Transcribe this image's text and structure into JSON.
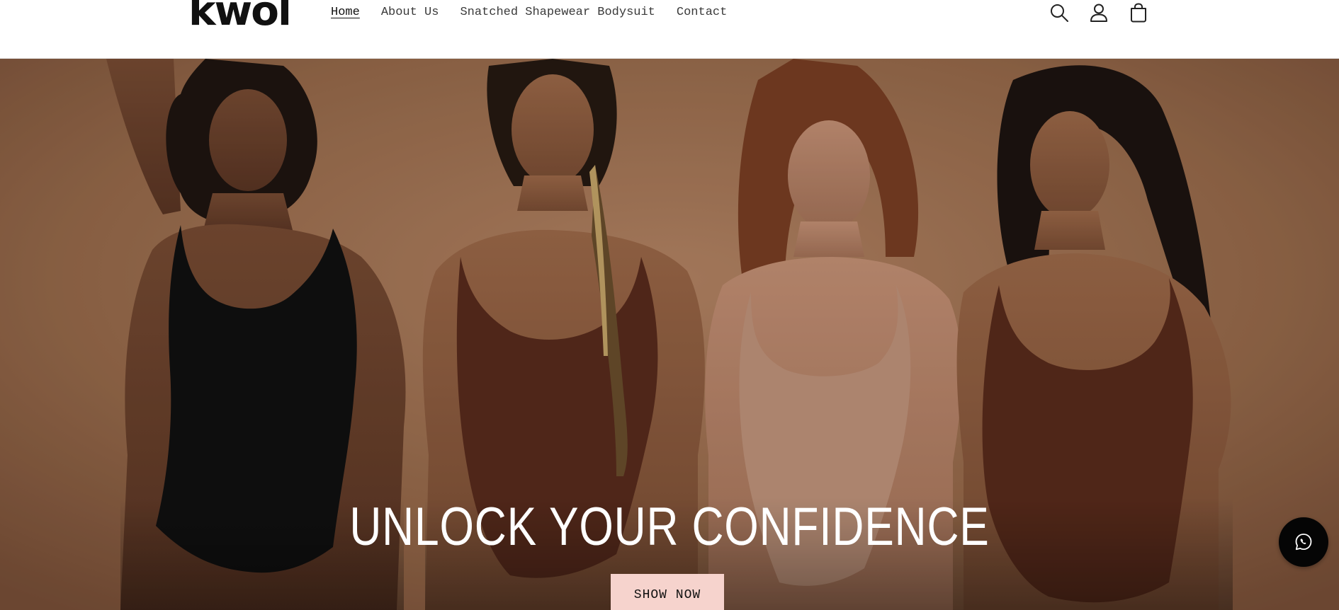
{
  "brand": {
    "logo_text": "kwol"
  },
  "nav": {
    "items": [
      {
        "label": "Home",
        "active": true
      },
      {
        "label": "About Us",
        "active": false
      },
      {
        "label": "Snatched Shapewear Bodysuit",
        "active": false
      },
      {
        "label": "Contact",
        "active": false
      }
    ]
  },
  "header_icons": [
    "search-icon",
    "account-icon",
    "cart-icon"
  ],
  "hero": {
    "headline": "UNLOCK YOUR CONFIDENCE",
    "cta_label": "SHOW NOW"
  },
  "floating": {
    "icon": "whatsapp-icon"
  },
  "colors": {
    "cta_background": "#f6d3cd",
    "hero_background": "#9b6f4f",
    "whatsapp_button": "#050505"
  }
}
